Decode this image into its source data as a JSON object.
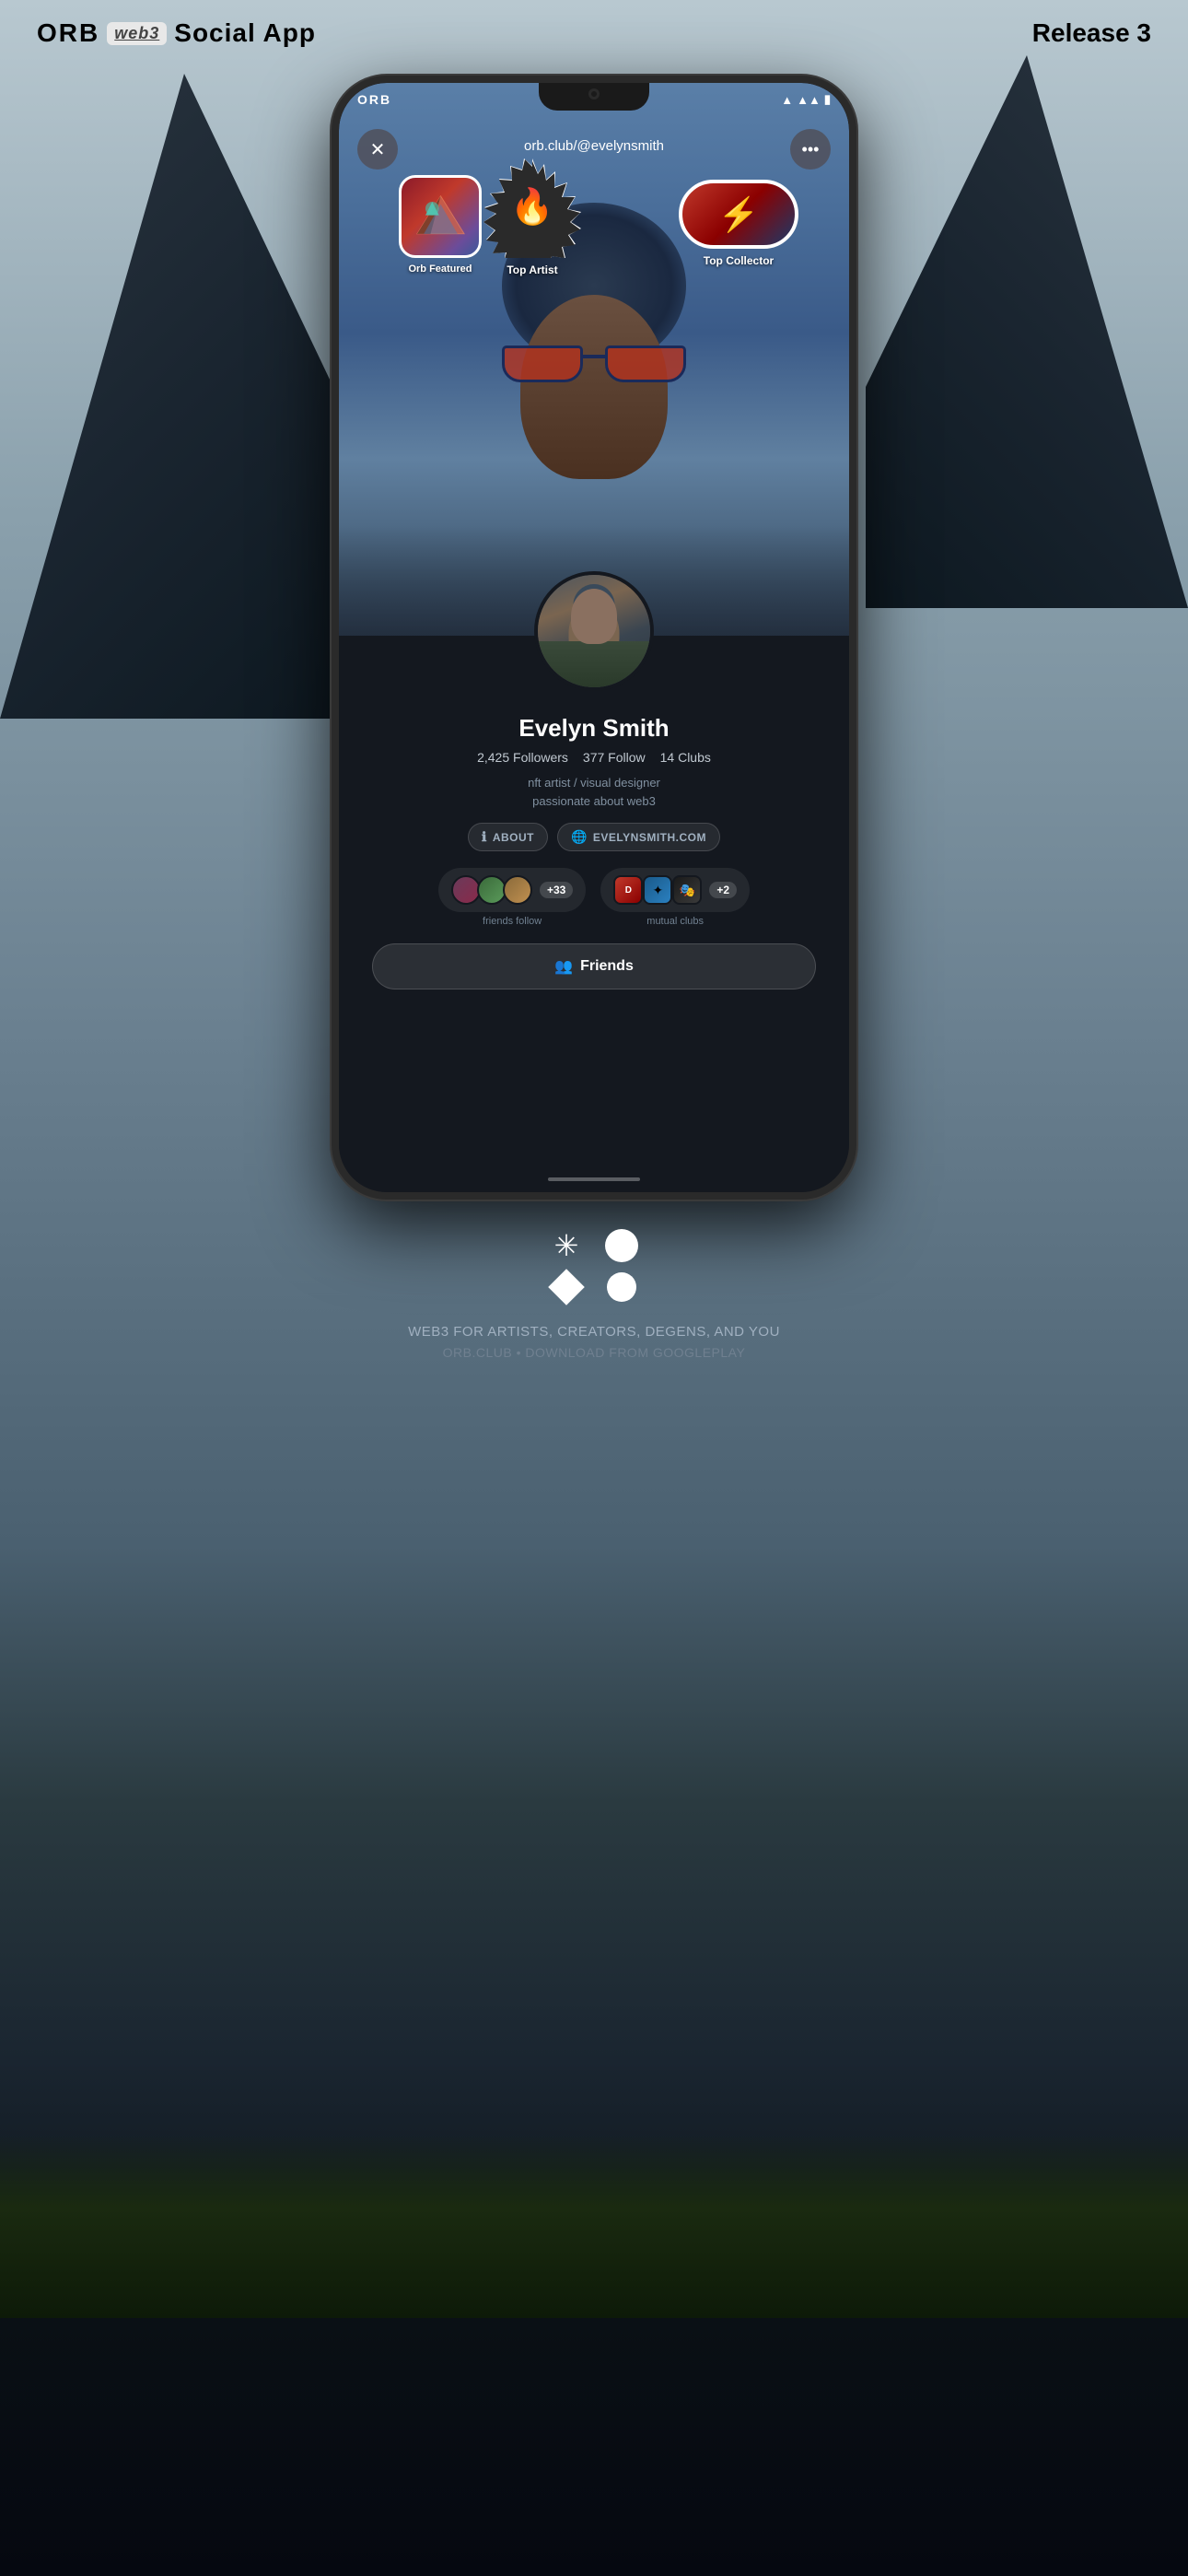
{
  "header": {
    "brand": "ORB",
    "web3_label": "web3",
    "app_name": "Social App",
    "release": "Release 3"
  },
  "status_bar": {
    "brand": "ORB",
    "wifi": "▲",
    "signal": "▲▲",
    "battery": "🔋"
  },
  "profile": {
    "url": "orb.club/@evelynsmith",
    "name": "Evelyn Smith",
    "followers": "2,425 Followers",
    "following": "377 Follow",
    "clubs": "14 Clubs",
    "bio_line1": "nft artist / visual designer",
    "bio_line2": "passionate about web3",
    "about_label": "ABOUT",
    "website_label": "EVELYNSMITH.COM",
    "friends_label": "Friends"
  },
  "badges": {
    "orb_featured": "Orb Featured",
    "top_artist": "Top Artist",
    "top_collector": "Top Collector"
  },
  "social": {
    "friends_count": "+33",
    "clubs_count": "+2",
    "friends_label": "friends follow",
    "clubs_label": "mutual clubs"
  },
  "buttons": {
    "close": "✕",
    "more": "•••",
    "friends_btn": "Friends",
    "about_icon": "ℹ",
    "globe_icon": "🌐"
  },
  "bottom": {
    "tagline": "WEB3 FOR ARTISTS, CREATORS, DEGENS, AND YOU",
    "download": "ORB.CLUB • DOWNLOAD FROM GOOGLEPLAY"
  }
}
